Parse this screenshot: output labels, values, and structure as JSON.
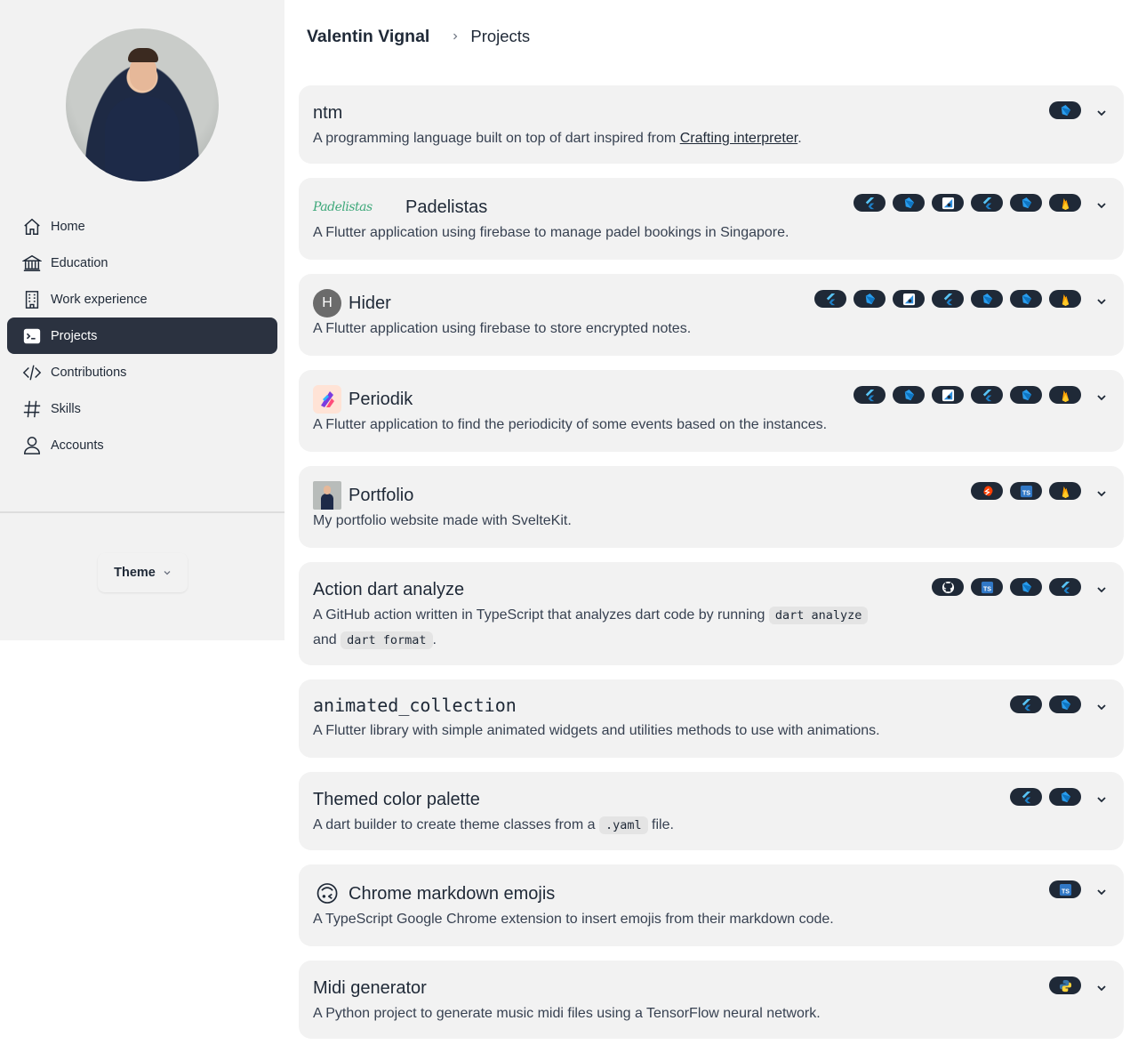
{
  "sidebar": {
    "nav": [
      {
        "label": "Home",
        "icon": "home-icon"
      },
      {
        "label": "Education",
        "icon": "bank-icon"
      },
      {
        "label": "Work experience",
        "icon": "building-icon"
      },
      {
        "label": "Projects",
        "icon": "terminal-icon",
        "active": true
      },
      {
        "label": "Contributions",
        "icon": "code-icon"
      },
      {
        "label": "Skills",
        "icon": "hashtag-icon"
      },
      {
        "label": "Accounts",
        "icon": "user-icon"
      }
    ],
    "theme_label": "Theme"
  },
  "header": {
    "owner": "Valentin Vignal",
    "current": "Projects"
  },
  "projects": [
    {
      "title": "ntm",
      "desc_before": "A programming language built on top of dart inspired from ",
      "link": "Crafting interpreter",
      "desc_after": ".",
      "badges": [
        "dart-icon"
      ]
    },
    {
      "title": "Padelistas",
      "logo_text": "Padelistas",
      "desc": "A Flutter application using firebase to manage padel bookings in Singapore.",
      "badges": [
        "flutter-icon",
        "dart-icon",
        "android-studio-icon",
        "flutter-icon",
        "dart-icon",
        "firebase-icon"
      ]
    },
    {
      "title": "Hider",
      "logo_letter": "H",
      "desc": "A Flutter application using firebase to store encrypted notes.",
      "badges": [
        "flutter-icon",
        "dart-icon",
        "android-studio-icon",
        "flutter-icon",
        "dart-icon",
        "dart-icon",
        "firebase-icon"
      ]
    },
    {
      "title": "Periodik",
      "desc": "A Flutter application to find the periodicity of some events based on the instances.",
      "badges": [
        "flutter-icon",
        "dart-icon",
        "android-studio-icon",
        "flutter-icon",
        "dart-icon",
        "firebase-icon"
      ]
    },
    {
      "title": "Portfolio",
      "desc": "My portfolio website made with SvelteKit.",
      "badges": [
        "svelte-icon",
        "typescript-icon",
        "firebase-icon"
      ]
    },
    {
      "title": "Action dart analyze",
      "desc_before": "A GitHub action written in TypeScript that analyzes dart code by running ",
      "code1": "dart analyze",
      "desc_mid": "and ",
      "code2": "dart format",
      "desc_after": ".",
      "badges": [
        "github-icon",
        "typescript-icon",
        "dart-icon",
        "flutter-icon"
      ]
    },
    {
      "title": "animated_collection",
      "desc": "A Flutter library with simple animated widgets and utilities methods to use with animations.",
      "badges": [
        "flutter-icon",
        "dart-icon"
      ]
    },
    {
      "title": "Themed color palette",
      "desc_before": "A dart builder to create theme classes from a ",
      "code1": ".yaml",
      "desc_after": " file.",
      "badges": [
        "flutter-icon",
        "dart-icon"
      ]
    },
    {
      "title": "Chrome markdown emojis",
      "emoji": "🙃",
      "desc": "A TypeScript Google Chrome extension to insert emojis from their markdown code.",
      "badges": [
        "typescript-icon"
      ]
    },
    {
      "title": "Midi generator",
      "desc": "A Python project to generate music midi files using a TensorFlow neural network.",
      "badges": [
        "python-icon"
      ]
    }
  ]
}
